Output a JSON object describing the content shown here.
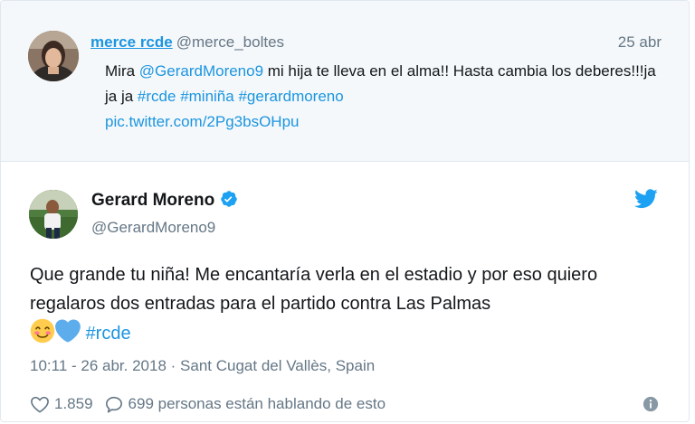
{
  "parent_tweet": {
    "name": "merce rcde",
    "handle": "@merce_boltes",
    "date": "25 abr",
    "text_1": "Mira ",
    "mention": "@GerardMoreno9",
    "text_2": " mi hija te lleva en el alma!! Hasta cambia los deberes!!!ja ja ja ",
    "hashtag_1": "#rcde",
    "hashtag_2": "#miniña",
    "hashtag_3": "#gerardmoreno",
    "pic_link": "pic.twitter.com/2Pg3bsOHpu"
  },
  "main_tweet": {
    "name": "Gerard Moreno",
    "handle": "@GerardMoreno9",
    "text": "Que grande tu niña! Me encantaría verla en el estadio y por eso quiero regalaros dos entradas para el partido contra Las Palmas ",
    "hashtag": "#rcde",
    "emoji_1": "smiling-face-icon",
    "emoji_2": "blue-heart-icon",
    "timestamp": "10:11 - 26 abr. 2018",
    "separator": " · ",
    "location": "Sant Cugat del Vallès, Spain",
    "likes": "1.859",
    "talking": "699 personas están hablando de esto"
  },
  "colors": {
    "link": "#1b95e0",
    "muted": "#657786",
    "text": "#14171a",
    "parent_bg": "#f5f8fa",
    "heart_emoji": "#5dadec",
    "smile_emoji": "#ffcc4d"
  }
}
